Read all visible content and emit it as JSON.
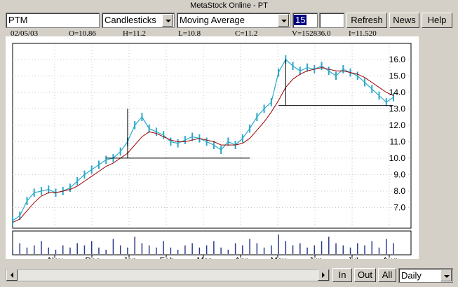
{
  "window_title": "MetaStock Online - PT",
  "toolbar": {
    "symbol_value": "PTM",
    "chart_style": "Candlesticks",
    "indicator": "Moving Average",
    "period_value": "15",
    "extra_value": "",
    "refresh_label": "Refresh",
    "news_label": "News",
    "help_label": "Help"
  },
  "quote": {
    "date": "02/05/03",
    "open": "O=10.86",
    "high": "H=11.2",
    "low": "L=10.8",
    "close": "C=11.2",
    "volume": "V=152836.0",
    "indicator": "I=11.520"
  },
  "bottom": {
    "in_label": "In",
    "out_label": "Out",
    "all_label": "All",
    "interval": "Daily"
  },
  "chart_data": {
    "type": "line",
    "title": "",
    "price_ticks": [
      "16.0",
      "15.0",
      "14.0",
      "13.0",
      "12.0",
      "11.0",
      "10.0",
      "9.0",
      "8.0",
      "7.0"
    ],
    "ylim": [
      6.0,
      16.8
    ],
    "month_labels": [
      "Nov",
      "Dec",
      "Jan",
      "Feb",
      "Mar",
      "Apr",
      "May",
      "Jun",
      "Jul",
      "Aug"
    ],
    "grid": true,
    "series": [
      {
        "kind": "price",
        "color": "#2ba8c8",
        "values": [
          6.2,
          6.5,
          7.4,
          7.9,
          8.0,
          8.1,
          7.9,
          8.0,
          8.2,
          8.6,
          9.0,
          9.3,
          9.6,
          9.9,
          10.0,
          10.4,
          11.0,
          12.0,
          12.5,
          11.8,
          11.6,
          11.4,
          11.0,
          10.9,
          11.1,
          11.3,
          11.2,
          11.0,
          10.8,
          10.5,
          11.0,
          10.8,
          11.2,
          11.8,
          12.5,
          13.0,
          13.4,
          15.2,
          16.0,
          15.6,
          15.3,
          15.5,
          15.4,
          15.6,
          15.3,
          15.0,
          15.4,
          15.2,
          15.0,
          14.6,
          14.2,
          13.8,
          13.4,
          13.7
        ]
      },
      {
        "kind": "moving-average",
        "color": "#a00000",
        "values": [
          6.1,
          6.3,
          6.8,
          7.3,
          7.7,
          7.9,
          7.9,
          8.0,
          8.1,
          8.3,
          8.6,
          8.9,
          9.2,
          9.5,
          9.7,
          10.0,
          10.3,
          10.8,
          11.3,
          11.6,
          11.5,
          11.3,
          11.1,
          11.0,
          11.0,
          11.1,
          11.2,
          11.1,
          11.0,
          10.8,
          10.8,
          10.8,
          10.9,
          11.2,
          11.7,
          12.2,
          12.8,
          13.5,
          14.3,
          14.8,
          15.1,
          15.3,
          15.4,
          15.5,
          15.4,
          15.3,
          15.3,
          15.2,
          15.1,
          14.9,
          14.6,
          14.3,
          14.0,
          13.8
        ]
      }
    ],
    "trendlines": [
      {
        "from": [
          13,
          10.0
        ],
        "to": [
          33,
          10.0
        ]
      },
      {
        "from": [
          37,
          13.2
        ],
        "to": [
          60,
          13.2
        ]
      },
      {
        "from": [
          16,
          10.0
        ],
        "to": [
          16,
          13.0
        ]
      },
      {
        "from": [
          38,
          13.2
        ],
        "to": [
          38,
          16.0
        ]
      }
    ],
    "volume": [
      2,
      5,
      3,
      4,
      6,
      3,
      2,
      4,
      3,
      5,
      4,
      6,
      3,
      2,
      7,
      4,
      3,
      8,
      5,
      4,
      3,
      6,
      3,
      2,
      4,
      5,
      3,
      4,
      6,
      3,
      2,
      5,
      4,
      7,
      5,
      3,
      4,
      9,
      6,
      4,
      5,
      3,
      4,
      6,
      8,
      5,
      4,
      3,
      5,
      4,
      6,
      3,
      7,
      5
    ]
  }
}
